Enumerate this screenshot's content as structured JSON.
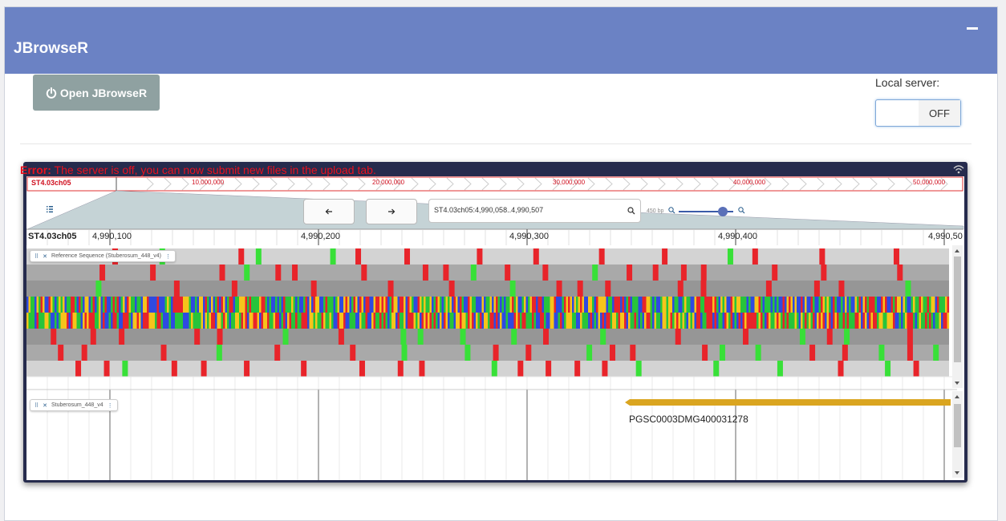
{
  "box": {
    "title": "JBrowseR"
  },
  "open_button": {
    "label": "Open JBrowseR"
  },
  "local_server": {
    "label": "Local server:",
    "state": "OFF"
  },
  "error": {
    "prefix": "Error:",
    "message": " The server is off, you can now submit new files in the upload tab."
  },
  "overview": {
    "chrom": "ST4.03ch05",
    "ticks": [
      "10,000,000",
      "20,000,000",
      "30,000,000",
      "40,000,000",
      "50,000,000"
    ]
  },
  "locstring": "ST4.03ch05:4,990,058..4,990,507",
  "zoom_label": "450 bp",
  "ruler": {
    "chrom": "ST4.03ch05",
    "ticks": [
      "4,990,100",
      "4,990,200",
      "4,990,300",
      "4,990,400",
      "4,990,50"
    ]
  },
  "tracks": {
    "reference": "Reference Sequence (Stuberosum_448_v4)",
    "genes": "Stuberosum_448_v4"
  },
  "gene": {
    "name": "PGSC0003DMG400031278"
  },
  "colors": {
    "header": "#6b82c4",
    "error": "#e8101e",
    "gene": "#daa520",
    "jbrowse_frame": "#262b4d"
  }
}
